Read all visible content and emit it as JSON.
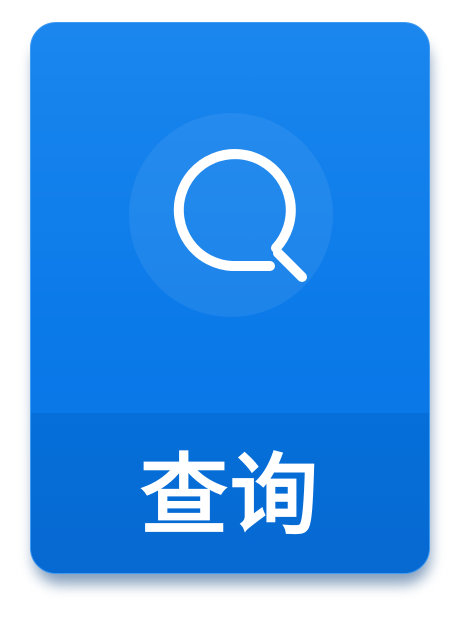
{
  "tile": {
    "label": "查询",
    "icon": "search-icon",
    "colors": {
      "top": "#0b7ae9",
      "bottom": "#0769d2",
      "text": "#ffffff"
    }
  }
}
